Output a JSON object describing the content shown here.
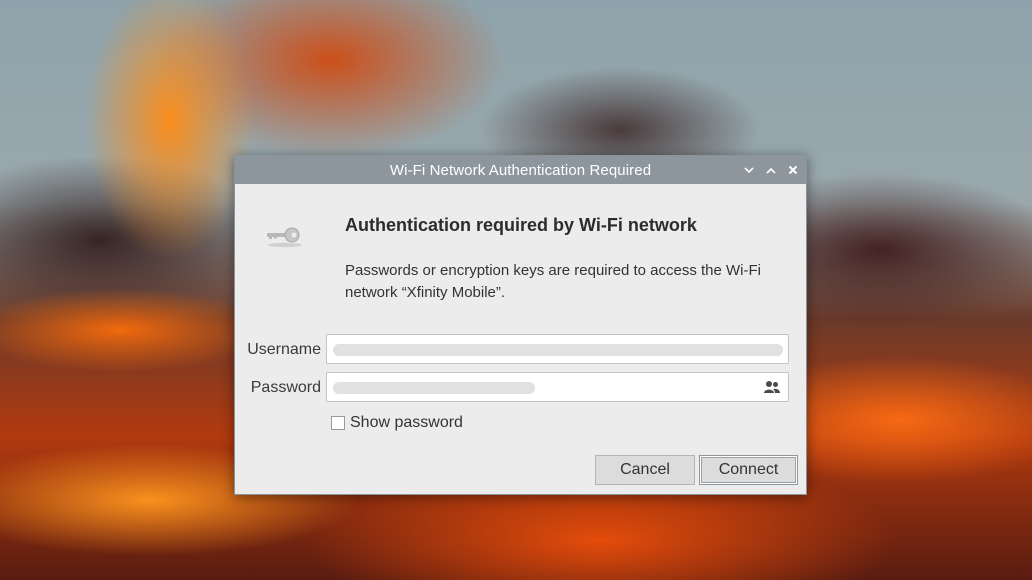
{
  "dialog": {
    "title": "Wi-Fi Network Authentication Required",
    "heading": "Authentication required by Wi-Fi network",
    "description": "Passwords or encryption keys are required to access the Wi-Fi network “Xfinity Mobile”.",
    "username_label": "Username",
    "password_label": "Password",
    "show_password_label": "Show password",
    "cancel_label": "Cancel",
    "connect_label": "Connect"
  },
  "window_controls": [
    "minimize-icon",
    "maximize-icon",
    "close-icon"
  ],
  "icons": {
    "key": "key-icon",
    "password_storage": "people-icon"
  },
  "colors": {
    "titlebar": "#8e969d",
    "dialog_bg": "#ececec",
    "button_bg": "#dcdcdc"
  }
}
